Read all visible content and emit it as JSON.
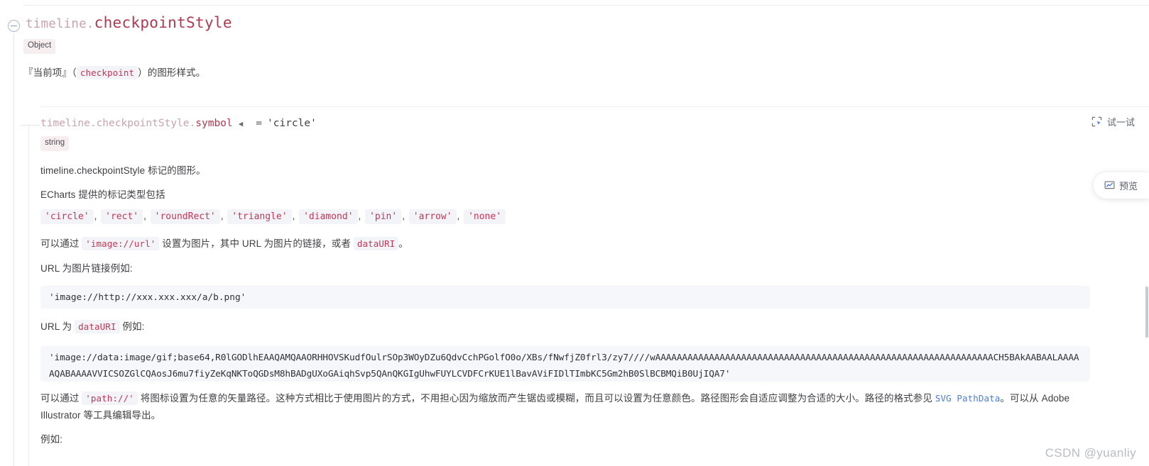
{
  "doc": {
    "node": {
      "prefix": "timeline.",
      "leaf": "checkpointStyle",
      "type_badge": "Object",
      "description": "『当前项』（checkpoint）的图形样式。",
      "description_chip": "checkpoint"
    },
    "child": {
      "sig_path": "timeline.checkpointStyle.",
      "sig_name": "symbol",
      "sig_caret": "◀",
      "sig_eq": "=",
      "sig_value": "'circle'",
      "type_badge": "string",
      "desc_marker": "timeline.checkpointStyle 标记的图形。",
      "desc_types_intro": "ECharts 提供的标记类型包括",
      "symbol_types": [
        "'circle'",
        "'rect'",
        "'roundRect'",
        "'triangle'",
        "'diamond'",
        "'pin'",
        "'arrow'",
        "'none'"
      ],
      "desc_image_before": "可以通过",
      "desc_image_chip": "'image://url'",
      "desc_image_mid": "设置为图片，其中 URL 为图片的链接，或者",
      "desc_image_chip2": "dataURI",
      "desc_image_after": "。",
      "desc_url_example": "URL 为图片链接例如:",
      "code_url": "'image://http://xxx.xxx.xxx/a/b.png'",
      "desc_datauri_before": "URL 为",
      "desc_datauri_chip": "dataURI",
      "desc_datauri_after": "例如:",
      "code_datauri": "'image://data:image/gif;base64,R0lGODlhEAAQAMQAAORHHOVSKudfOulrSOp3WOyDZu6QdvCchPGolfO0o/XBs/fNwfjZ0frl3/zy7////wAAAAAAAAAAAAAAAAAAAAAAAAAAAAAAAAAAAAAAAAAAAAAAAAAAAAAAAAAAAAAAACH5BAkAABAALAAAAAQABAAAAVVICSOZGlCQAosJ6mu7fiyZeKqNKToQGDsM8hBADgUXoGAiqhSvp5QAnQKGIgUhwFUYLCVDFCrKUE1lBavAViFIDlTImbKC5Gm2hB0SlBCBMQiB0UjIQA7'",
      "desc_path_before": "可以通过",
      "desc_path_chip": "'path://'",
      "desc_path_mid": "将图标设置为任意的矢量路径。这种方式相比于使用图片的方式，不用担心因为缩放而产生锯齿或模糊，而且可以设置为任意颜色。路径图形会自适应调整为合适的大小。路径的格式参见",
      "desc_path_link": "SVG PathData",
      "desc_path_after": "。可以从 Adobe Illustrator 等工具编辑导出。",
      "desc_example_label": "例如:"
    }
  },
  "actions": {
    "try_it_label": "试一试",
    "try_it_icon": "expand-run-icon",
    "preview_label": "预览",
    "preview_icon": "chart-preview-icon",
    "collapse_icon": "circle-minus-icon"
  },
  "watermark": {
    "text": "CSDN @yuanliy"
  },
  "theme": {
    "accent": "#b03a52",
    "chip_bg": "#f3f4f7",
    "chip_text": "#c0395a",
    "link": "#4b7fd6",
    "code_bg": "#f6f7fa",
    "rail": "#e3e4ea"
  }
}
